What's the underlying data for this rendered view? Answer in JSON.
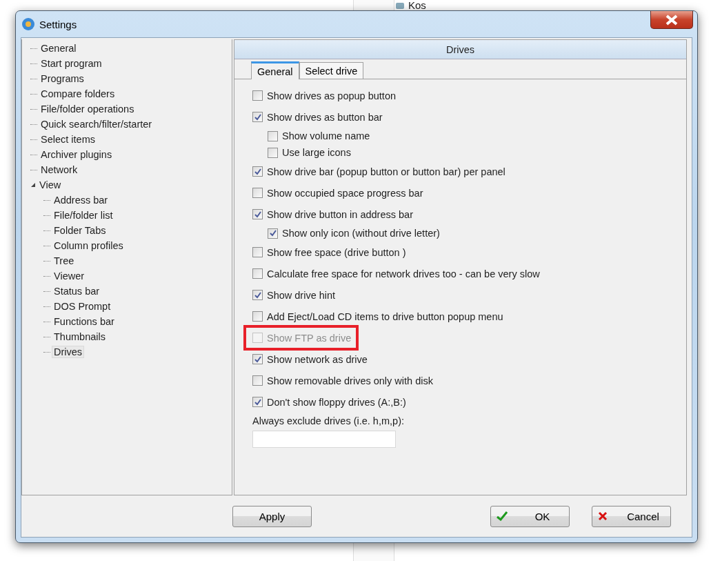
{
  "background": {
    "item": "Kos"
  },
  "window": {
    "title": "Settings"
  },
  "tree": [
    {
      "label": "General",
      "selected": false
    },
    {
      "label": "Start program",
      "selected": false
    },
    {
      "label": "Programs",
      "selected": false
    },
    {
      "label": "Compare folders",
      "selected": false
    },
    {
      "label": "File/folder operations",
      "selected": false
    },
    {
      "label": "Quick search/filter/starter",
      "selected": false
    },
    {
      "label": "Select items",
      "selected": false
    },
    {
      "label": "Archiver plugins",
      "selected": false
    },
    {
      "label": "Network",
      "selected": false
    },
    {
      "label": "View",
      "selected": false,
      "expanded": true,
      "children": [
        {
          "label": "Address bar",
          "selected": false
        },
        {
          "label": "File/folder list",
          "selected": false
        },
        {
          "label": "Folder Tabs",
          "selected": false
        },
        {
          "label": "Column profiles",
          "selected": false
        },
        {
          "label": "Tree",
          "selected": false
        },
        {
          "label": "Viewer",
          "selected": false
        },
        {
          "label": "Status bar",
          "selected": false
        },
        {
          "label": "DOS Prompt",
          "selected": false
        },
        {
          "label": "Functions bar",
          "selected": false
        },
        {
          "label": "Thumbnails",
          "selected": false
        },
        {
          "label": "Drives",
          "selected": true
        }
      ]
    }
  ],
  "panel": {
    "title": "Drives",
    "tabs": [
      {
        "label": "General",
        "selected": true
      },
      {
        "label": "Select drive",
        "selected": false
      }
    ],
    "options": [
      {
        "label": "Show drives as popup button",
        "checked": false,
        "disabled": false,
        "highlighted": false
      },
      {
        "label": "Show drives as button bar",
        "checked": true,
        "disabled": false,
        "highlighted": false,
        "children": [
          {
            "label": "Show volume name",
            "checked": false,
            "disabled": false,
            "highlighted": false
          },
          {
            "label": "Use large icons",
            "checked": false,
            "disabled": false,
            "highlighted": false
          }
        ]
      },
      {
        "label": "Show drive bar (popup button or button bar) per panel",
        "checked": true,
        "disabled": false,
        "highlighted": false
      },
      {
        "label": "Show occupied space progress bar",
        "checked": false,
        "disabled": false,
        "highlighted": false
      },
      {
        "label": "Show drive button in address bar",
        "checked": true,
        "disabled": false,
        "highlighted": false,
        "children": [
          {
            "label": "Show only icon (without drive letter)",
            "checked": true,
            "disabled": false,
            "highlighted": false
          }
        ]
      },
      {
        "label": "Show free space (drive button )",
        "checked": false,
        "disabled": false,
        "highlighted": false
      },
      {
        "label": "Calculate free space for network drives too - can be very slow",
        "checked": false,
        "disabled": false,
        "highlighted": false
      },
      {
        "label": "Show drive hint",
        "checked": true,
        "disabled": false,
        "highlighted": false
      },
      {
        "label": "Add Eject/Load CD items to drive button popup menu",
        "checked": false,
        "disabled": false,
        "highlighted": false
      },
      {
        "label": "Show FTP as drive",
        "checked": false,
        "disabled": true,
        "highlighted": true
      },
      {
        "label": "Show network as drive",
        "checked": true,
        "disabled": false,
        "highlighted": false
      },
      {
        "label": "Show removable drives only with disk",
        "checked": false,
        "disabled": false,
        "highlighted": false
      },
      {
        "label": "Don't show floppy drives (A:,B:)",
        "checked": true,
        "disabled": false,
        "highlighted": false
      }
    ],
    "exclude": {
      "label": "Always exclude drives (i.e. h,m,p):"
    }
  },
  "buttons": [
    {
      "kind": "apply",
      "label": "Apply"
    },
    {
      "kind": "ok",
      "label": "OK"
    },
    {
      "kind": "cancel",
      "label": "Cancel"
    }
  ]
}
